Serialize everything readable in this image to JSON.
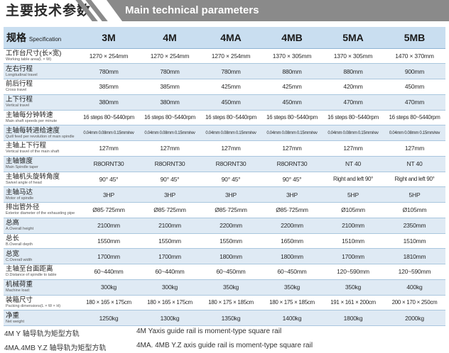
{
  "header": {
    "title_cn": "主要技术参数",
    "title_en": "Main technical parameters"
  },
  "table": {
    "header_label_cn": "规格",
    "header_label_en": "Specification",
    "models": [
      "3M",
      "4M",
      "4MA",
      "4MB",
      "5MA",
      "5MB"
    ],
    "rows": [
      {
        "cn": "工作台尺寸(长×宽)",
        "en": "Working table area(L × W)",
        "values": [
          "1270 × 254mm",
          "1270 × 254mm",
          "1270 × 254mm",
          "1370 × 305mm",
          "1370 × 305mm",
          "1470 × 370mm"
        ]
      },
      {
        "cn": "左右行程",
        "en": "Longitudinal travel",
        "values": [
          "780mm",
          "780mm",
          "780mm",
          "880mm",
          "880mm",
          "900mm"
        ]
      },
      {
        "cn": "前后行程",
        "en": "Cross travel",
        "values": [
          "385mm",
          "385mm",
          "425mm",
          "425mm",
          "420mm",
          "450mm"
        ]
      },
      {
        "cn": "上下行程",
        "en": "Vertical travel",
        "values": [
          "380mm",
          "380mm",
          "450mm",
          "450mm",
          "470mm",
          "470mm"
        ]
      },
      {
        "cn": "主轴每分钟转速",
        "en": "Main shaft speeds per minute",
        "values": [
          "16 steps 80~5440rpm",
          "16 steps 80~5440rpm",
          "16 steps 80~5440rpm",
          "16 steps 80~5440rpm",
          "16 steps 80~5440rpm",
          "16 steps 80~5440rpm"
        ]
      },
      {
        "cn": "主轴每转进给速度",
        "en": "Quill feed per revolution of main spindle",
        "values": [
          "0.04mm 0.08mm 0.15mm/rev",
          "0.04mm 0.08mm 0.15mm/rev",
          "0.04mm 0.08mm 0.15mm/rev",
          "0.04mm 0.08mm 0.15mm/rev",
          "0.04mm 0.08mm 0.15mm/rev",
          "0.04mm 0.08mm 0.15mm/rev"
        ]
      },
      {
        "cn": "主轴上下行程",
        "en": "Vertical travel of the main shaft",
        "values": [
          "127mm",
          "127mm",
          "127mm",
          "127mm",
          "127mm",
          "127mm"
        ]
      },
      {
        "cn": "主轴锥度",
        "en": "Main Spindle taper",
        "values": [
          "R8ORNT30",
          "R8ORNT30",
          "R8ORNT30",
          "R8ORNT30",
          "NT 40",
          "NT 40"
        ]
      },
      {
        "cn": "主轴机头旋转角度",
        "en": "Swivel angle of head",
        "values": [
          "90°   45°",
          "90°   45°",
          "90°   45°",
          "90°   45°",
          "Right and left 90°",
          "Right and left 90°"
        ]
      },
      {
        "cn": "主轴马达",
        "en": "Motor of spindle",
        "values": [
          "3HP",
          "3HP",
          "3HP",
          "3HP",
          "5HP",
          "5HP"
        ]
      },
      {
        "cn": "排出管外径",
        "en": "Exterior diameter of the exhausting pipe",
        "values": [
          "Ø85·725mm",
          "Ø85·725mm",
          "Ø85·725mm",
          "Ø85·725mm",
          "Ø105mm",
          "Ø105mm"
        ]
      },
      {
        "cn": "总高",
        "en": "A.Overall height",
        "values": [
          "2100mm",
          "2100mm",
          "2200mm",
          "2200mm",
          "2100mm",
          "2350mm"
        ]
      },
      {
        "cn": "总长",
        "en": "B.Overall depth",
        "values": [
          "1550mm",
          "1550mm",
          "1550mm",
          "1650mm",
          "1510mm",
          "1510mm"
        ]
      },
      {
        "cn": "总宽",
        "en": "C.Overall width",
        "values": [
          "1700mm",
          "1700mm",
          "1800mm",
          "1800mm",
          "1700mm",
          "1810mm"
        ]
      },
      {
        "cn": "主轴至台面距离",
        "en": "D.Distance of spindle to table",
        "values": [
          "60~440mm",
          "60~440mm",
          "60~450mm",
          "60~450mm",
          "120~590mm",
          "120~590mm"
        ]
      },
      {
        "cn": "机械荷重",
        "en": "Machine load:",
        "values": [
          "300kg",
          "300kg",
          "350kg",
          "350kg",
          "350kg",
          "400kg"
        ]
      },
      {
        "cn": "装箱尺寸",
        "en": "Packing dimensions(L × W × H)",
        "values": [
          "180 × 165 × 175cm",
          "180 × 165 × 175cm",
          "180 × 175 × 185cm",
          "180 × 175 × 185cm",
          "191 × 161 × 200cm",
          "200 × 170 × 250cm"
        ]
      },
      {
        "cn": "净重",
        "en": "Net weight",
        "values": [
          "1250kg",
          "1300kg",
          "1350kg",
          "1400kg",
          "1800kg",
          "2000kg"
        ]
      }
    ]
  },
  "notes": [
    {
      "cn": "4M Y 轴导轨为矩型方轨",
      "en": "4M  Yaxis guide rail is moment-type square rail"
    },
    {
      "cn": "4MA.4MB Y.Z 轴导轨为矩型方轨",
      "en": "4MA. 4MB Y.Z axis guide rail is moment-type square rail"
    }
  ]
}
